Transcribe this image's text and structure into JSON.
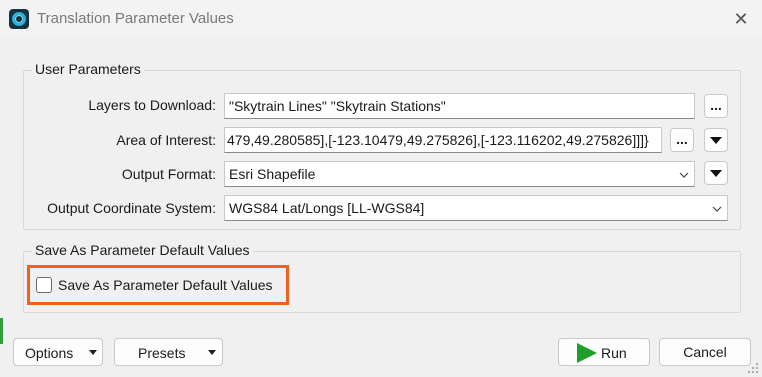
{
  "window": {
    "title": "Translation Parameter Values"
  },
  "user_parameters": {
    "title": "User Parameters",
    "layers_to_download": {
      "label": "Layers to Download:",
      "value": "\"Skytrain Lines\" \"Skytrain Stations\"",
      "browse_label": "..."
    },
    "area_of_interest": {
      "label": "Area of Interest:",
      "value": "479,49.280585],[-123.10479,49.275826],[-123.116202,49.275826]]]}",
      "browse_label": "..."
    },
    "output_format": {
      "label": "Output Format:",
      "value": "Esri Shapefile"
    },
    "output_coordinate_system": {
      "label": "Output Coordinate System:",
      "value": "WGS84 Lat/Longs [LL-WGS84]"
    }
  },
  "defaults_group": {
    "title": "Save As Parameter Default Values",
    "checkbox_label": "Save As Parameter Default Values",
    "checked": false
  },
  "footer": {
    "options_label": "Options",
    "presets_label": "Presets",
    "run_label": "Run",
    "cancel_label": "Cancel"
  },
  "colors": {
    "highlight": "#f0611f",
    "run_icon": "#1f9e2a"
  }
}
